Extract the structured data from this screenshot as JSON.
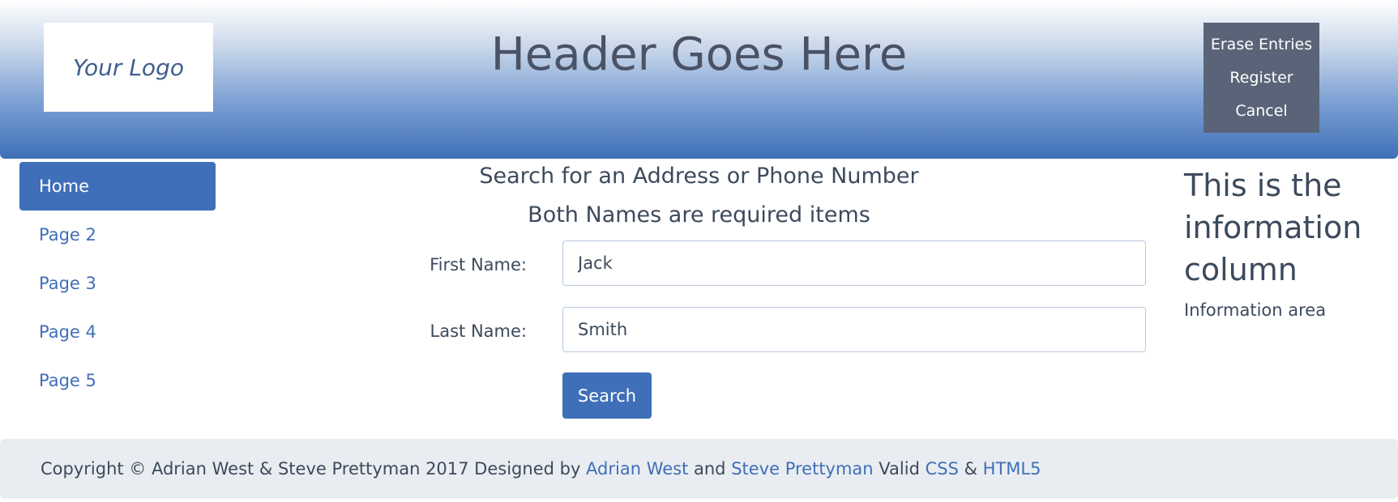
{
  "header": {
    "logo_text": "Your Logo",
    "title": "Header Goes Here",
    "buttons": [
      "Erase Entries",
      "Register",
      "Cancel"
    ]
  },
  "nav": {
    "items": [
      {
        "label": "Home",
        "active": true
      },
      {
        "label": "Page 2"
      },
      {
        "label": "Page 3"
      },
      {
        "label": "Page 4"
      },
      {
        "label": "Page 5"
      }
    ]
  },
  "main": {
    "heading": "Search for an Address or Phone Number",
    "subheading": "Both Names are required items",
    "first_name_label": "First Name:",
    "first_name_value": "Jack",
    "last_name_label": "Last Name:",
    "last_name_value": "Smith",
    "search_label": "Search"
  },
  "info": {
    "title": "This is the information column",
    "text": "Information area"
  },
  "footer": {
    "copyright": "Copyright © Adrian West & Steve Prettyman 2017 Designed by ",
    "link_adrian": "Adrian West",
    "and_text": " and ",
    "link_steve": "Steve Prettyman",
    "valid_text": " Valid ",
    "link_css": "CSS",
    "amp_text": " & ",
    "link_html5": "HTML5"
  },
  "colors": {
    "accent": "#3f6fb8",
    "header_button_bg": "#5a6478",
    "footer_bg": "#e9edf1"
  }
}
